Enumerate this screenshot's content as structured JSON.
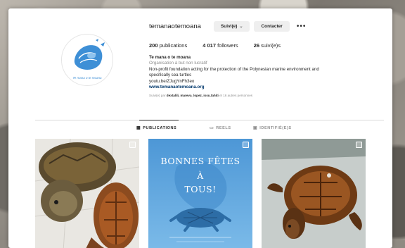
{
  "profile": {
    "username": "temanaotemoana",
    "follow_button": "Suivi(e)",
    "contact_button": "Contacter",
    "more": "•••",
    "stats": {
      "publications": "200",
      "publications_label": "publications",
      "followers": "4 017",
      "followers_label": "followers",
      "following": "26",
      "following_label": "suivi(e)s"
    },
    "bio": {
      "name": "Te mana o te moana",
      "category": "Organisation à but non lucratif",
      "line1": "Non-profit foundation acting for the protection of the Polynesian marine environment and",
      "line2": "specifically sea turtles",
      "line3": "youtu.be/ZJugYnFh3eo",
      "website": "www.temanaotemoana.org"
    },
    "followed_by": {
      "prefix": "Suivi(e) par",
      "names": "dextalili, mareva_lopez, issu.tahiti",
      "suffix": "et 16 autres personnes"
    },
    "avatar_text": "Te mana o te moana"
  },
  "tabs": [
    {
      "label": "PUBLICATIONS",
      "icon": "grid-icon"
    },
    {
      "label": "REELS",
      "icon": "reels-icon"
    },
    {
      "label": "IDENTIFIÉ(E)S",
      "icon": "tagged-icon"
    }
  ],
  "posts": {
    "post2_line1": "BONNES FÊTES",
    "post2_line2": "À",
    "post2_line3": "TOUS!"
  },
  "colors": {
    "accent_blue": "#3e8fd6",
    "link": "#00376b",
    "muted": "#8e8e8e",
    "post_blue": "#5fa6de"
  }
}
